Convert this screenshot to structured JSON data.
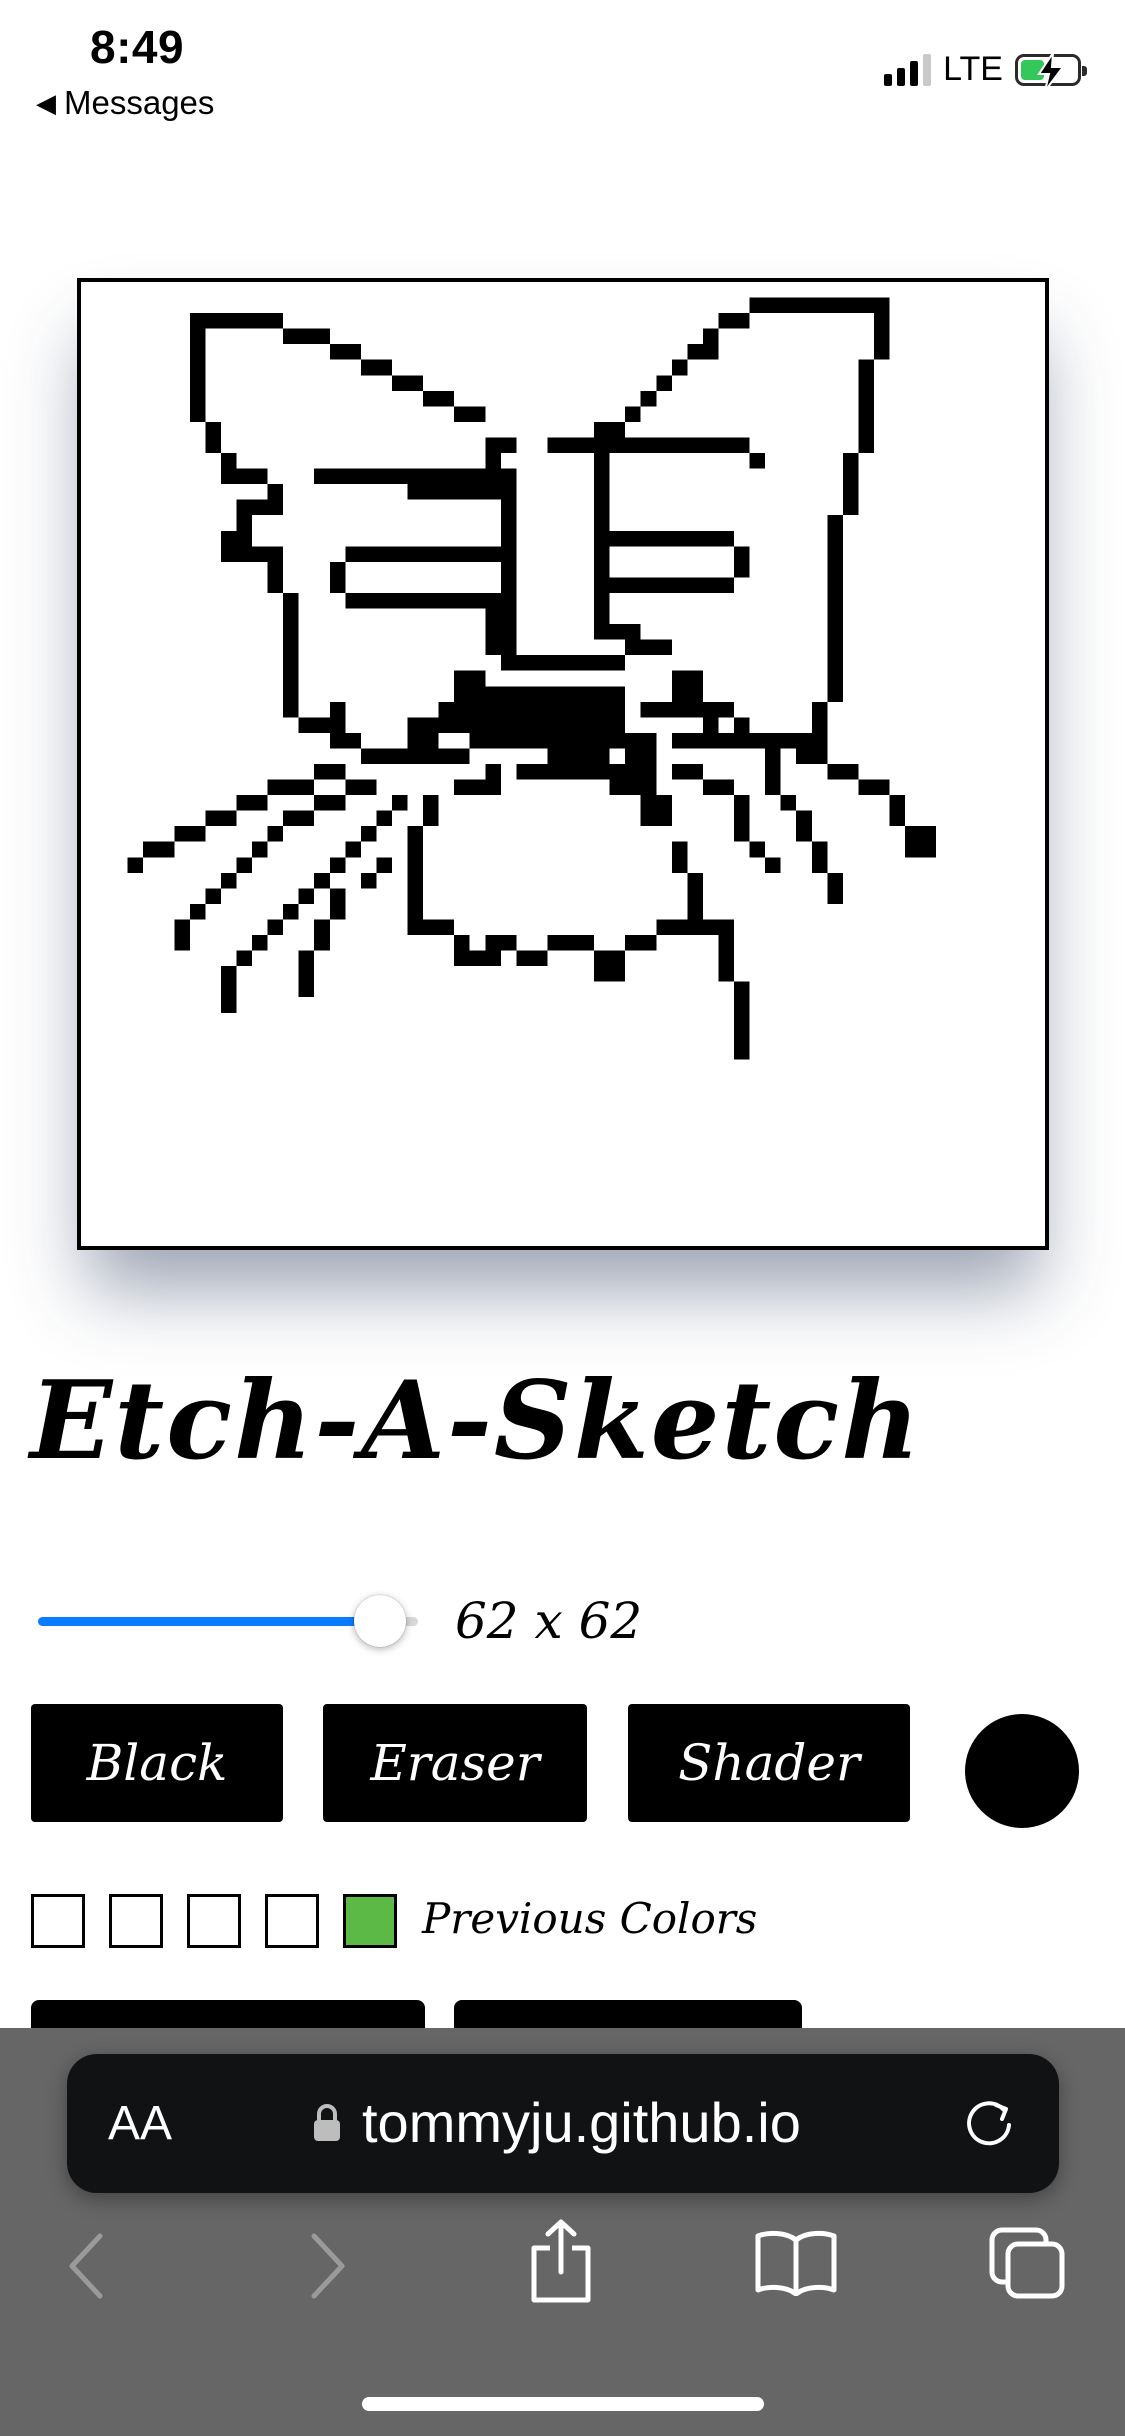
{
  "status_bar": {
    "time": "8:49",
    "back_app": "Messages",
    "network": "LTE",
    "signal_bars": 3,
    "battery_charging": true
  },
  "app": {
    "title": "Etch-A-Sketch",
    "grid_size_label": "62 x 62",
    "grid_slider_fraction": 0.9,
    "buttons": {
      "black": "Black",
      "eraser": "Eraser",
      "shader": "Shader"
    },
    "current_color": "#000000",
    "previous_colors": [
      "#ffffff",
      "#ffffff",
      "#ffffff",
      "#ffffff",
      "#5cb946"
    ],
    "previous_colors_label": "Previous Colors"
  },
  "browser": {
    "text_size_button": "AA",
    "url": "tommyju.github.io",
    "accent_colors": {
      "slider": "#0a7cff",
      "bar": "#666666",
      "field": "#111214"
    }
  }
}
